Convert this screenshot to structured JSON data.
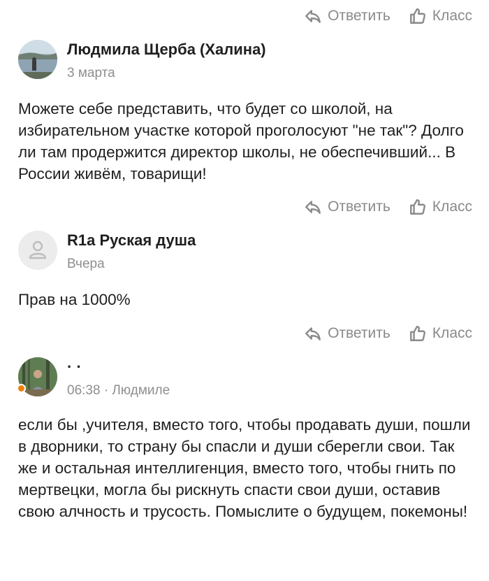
{
  "actions": {
    "reply_label": "Ответить",
    "like_label": "Класс"
  },
  "comments": [
    {
      "author": "Людмила Щерба (Халина)",
      "date": "3 марта",
      "reply_to": "",
      "text": "Можете себе представить, что будет со школой, на избирательном участке которой проголосуют \"не так\"? Долго ли там продержится директор школы, не обеспечивший... В России живём, товарищи!"
    },
    {
      "author": "R1a Руская душа",
      "date": "Вчера",
      "reply_to": "",
      "text": "Прав на 1000%"
    },
    {
      "author": "· ·",
      "date": "06:38",
      "reply_to": "· Людмиле",
      "text": "если бы ,учителя, вместо того, чтобы продавать души, пошли в дворники, то страну бы спасли и души сберегли свои. Так же и остальная интеллигенция, вместо того, чтобы гнить по мертвецки, могла бы рискнуть спасти свои души, оставив свою алчность и трусость. Помыслите о будущем, покемоны!"
    }
  ],
  "colors": {
    "muted": "#8a8a8a",
    "online": "#ee8208"
  }
}
